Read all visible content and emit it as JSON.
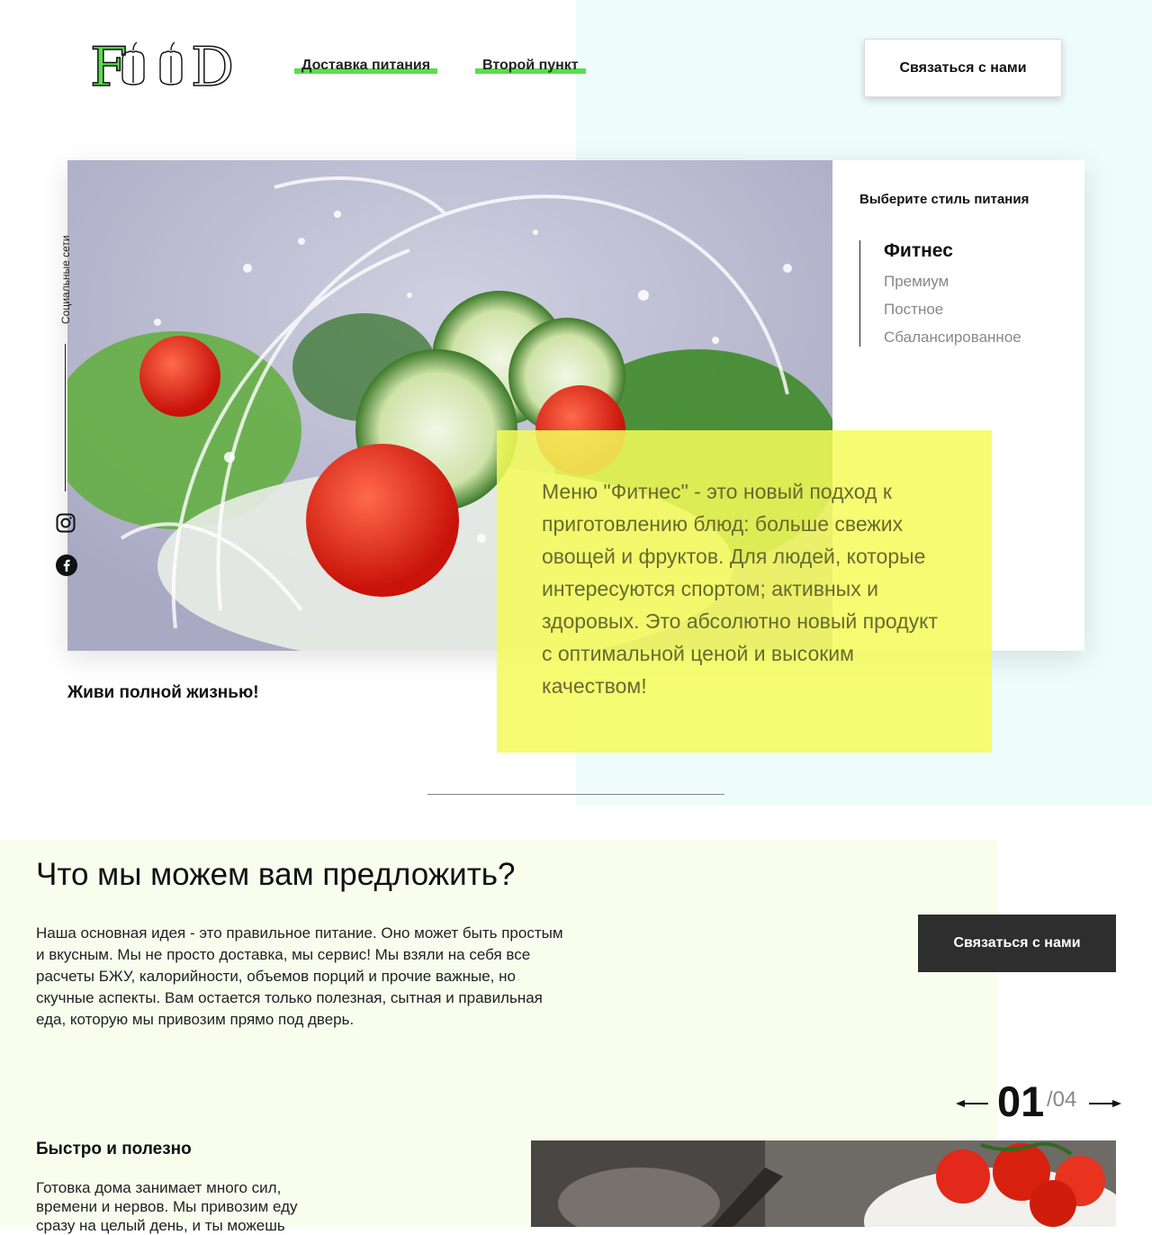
{
  "header": {
    "logo_text": "FOOD",
    "nav": [
      {
        "label": "Доставка питания"
      },
      {
        "label": "Второй пункт"
      }
    ],
    "contact_button": "Связаться с нами"
  },
  "hero": {
    "social_label": "Социальные сети",
    "style_title": "Выберите стиль питания",
    "styles": [
      {
        "label": "Фитнес",
        "active": true
      },
      {
        "label": "Премиум",
        "active": false
      },
      {
        "label": "Постное",
        "active": false
      },
      {
        "label": "Сбалансированное",
        "active": false
      }
    ],
    "description": "Меню \"Фитнес\" - это новый подход к приготовлению блюд: больше свежих овощей и фруктов. Для людей, которые интересуются спортом; активных и здоровых. Это абсолютно новый продукт с оптимальной ценой и высоким качеством!",
    "slogan": "Живи полной жизнью!"
  },
  "offer": {
    "title": "Что мы можем вам предложить?",
    "text": "Наша основная идея - это правильное питание. Оно может быть простым и вкусным. Мы не просто доставка, мы сервис! Мы взяли на себя все расчеты БЖУ, калорийности, объемов порций и прочие важные, но скучные аспекты. Вам остается только полезная, сытная и правильная еда, которую мы привозим прямо под дверь.",
    "contact_button": "Связаться с нами",
    "slider": {
      "current": "01",
      "total": "/04"
    },
    "feature_title": "Быстро и полезно",
    "feature_text": "Готовка дома занимает много сил, времени и нервов. Мы привозим еду сразу на целый день, и ты можешь"
  },
  "colors": {
    "accent_green": "#56e04a",
    "highlight_yellow": "#f4fc5a",
    "bg_mint": "#effcfc",
    "bg_cream": "#f8fdee",
    "dark_button": "#2e2e2e"
  }
}
